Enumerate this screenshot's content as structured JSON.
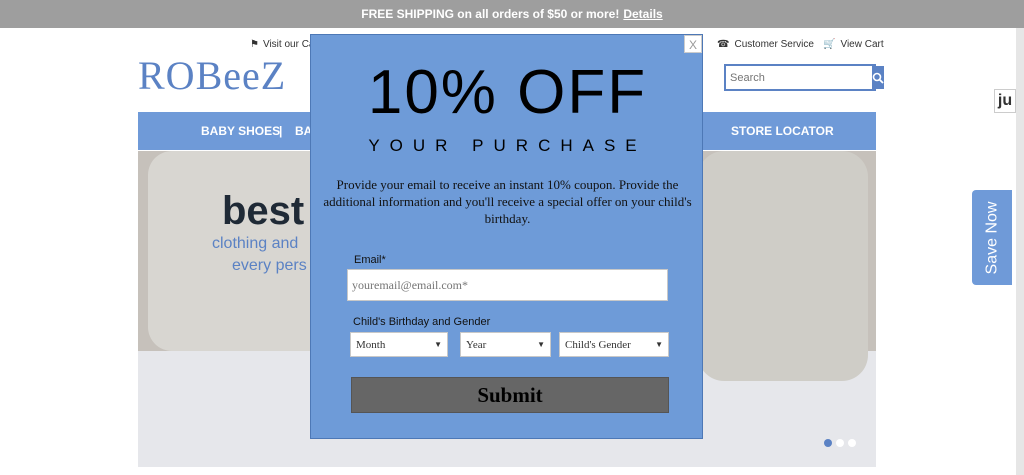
{
  "topbar": {
    "text": "FREE SHIPPING on all orders of $50 or more!",
    "link": "Details"
  },
  "header": {
    "logo": "ROBeeZ",
    "visit": "Visit our Ca",
    "customer_service": "Customer Service",
    "view_cart": "View Cart",
    "search_placeholder": "Search"
  },
  "nav": {
    "items": [
      "BABY SHOES",
      "|",
      "BA",
      "STORE LOCATOR"
    ]
  },
  "hero": {
    "headline": "best fr",
    "line1": "clothing and",
    "line2": "every pers"
  },
  "widgets": {
    "ju": "ju",
    "save_now": "Save Now"
  },
  "modal": {
    "close": "X",
    "title": "10% OFF",
    "subtitle": "YOUR PURCHASE",
    "description": "Provide your email to receive an instant 10% coupon. Provide the additional information and you'll receive a special offer on your child's birthday.",
    "email_label": "Email*",
    "email_placeholder": "youremail@email.com*",
    "bday_label": "Child's Birthday and Gender",
    "month": "Month",
    "year": "Year",
    "gender": "Child's Gender",
    "submit": "Submit"
  },
  "colors": {
    "accent": "#6f9ad8",
    "brand": "#5b82c4",
    "topbar": "#9e9e9e",
    "modal_bg": "#6e9bd8",
    "submit_bg": "#666666"
  }
}
